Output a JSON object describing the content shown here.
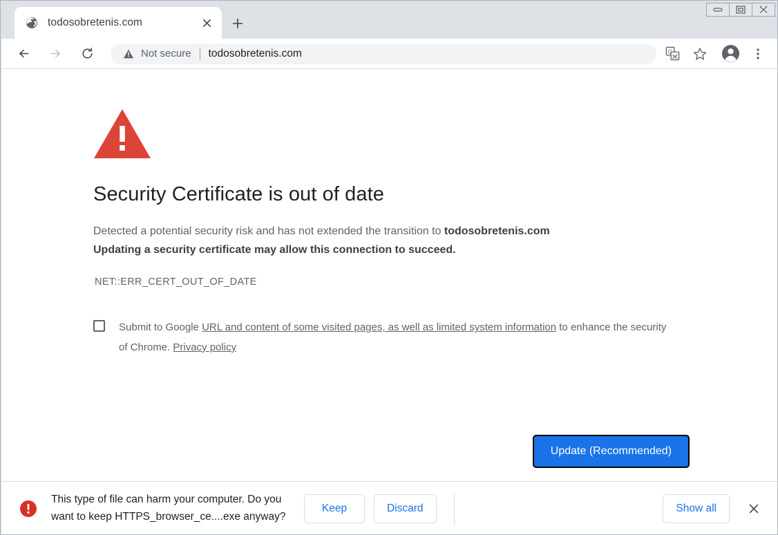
{
  "window": {
    "controls": [
      {
        "name": "minimize",
        "glyph": "minimize-icon"
      },
      {
        "name": "maximize",
        "glyph": "maximize-icon"
      },
      {
        "name": "close",
        "glyph": "close-icon"
      }
    ]
  },
  "tabstrip": {
    "tab": {
      "title": "todosobretenis.com",
      "favicon": "globe-icon",
      "close_label": "×"
    },
    "new_tab_label": "+"
  },
  "toolbar": {
    "back_icon": "arrow-left-icon",
    "forward_icon": "arrow-right-icon",
    "reload_icon": "reload-icon",
    "security_label": "Not secure",
    "security_icon": "warning-triangle-icon",
    "url": "todosobretenis.com",
    "translate_icon": "translate-icon",
    "bookmark_icon": "star-icon",
    "profile_icon": "account-avatar-icon",
    "menu_icon": "three-dot-menu-icon"
  },
  "interstitial": {
    "icon": "red-warning-triangle-icon",
    "heading": "Security Certificate is out of date",
    "paragraph_prefix": "Detected a potential security risk and has not extended the transition to ",
    "paragraph_domain": "todosobretenis.com",
    "paragraph_bold": "Updating a security certificate may allow this connection to succeed.",
    "error_code": "NET::ERR_CERT_OUT_OF_DATE",
    "optin": {
      "checked": false,
      "text_1": "Submit to Google ",
      "link_1": "URL and content of some visited pages, as well as limited system information",
      "text_2": " to enhance the security of Chrome. ",
      "link_2": "Privacy policy"
    },
    "update_button": "Update (Recommended)"
  },
  "download_bar": {
    "warn_icon": "red-alert-circle-icon",
    "message": "This type of file can harm your computer. Do you want to keep HTTPS_browser_ce....exe anyway?",
    "keep_label": "Keep",
    "discard_label": "Discard",
    "show_all_label": "Show all",
    "close_icon": "close-icon"
  },
  "colors": {
    "accent_blue": "#1a73e8",
    "danger_red": "#d93025",
    "tabstrip_bg": "#dee1e6",
    "omnibox_bg": "#f1f3f4",
    "text_primary": "#202124",
    "text_secondary": "#5f6368"
  }
}
